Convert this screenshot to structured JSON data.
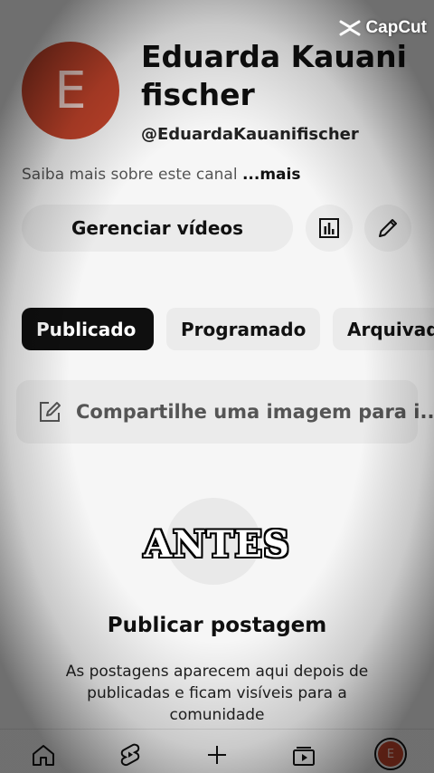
{
  "watermark": {
    "label": "CapCut",
    "icon": "capcut-logo-icon"
  },
  "channel": {
    "avatar_letter": "E",
    "avatar_color": "#c4442b",
    "name": "Eduarda Kauani fischer",
    "handle": "@EduardaKauanifischer",
    "about_text": "Saiba mais sobre este canal ",
    "about_more": "...mais"
  },
  "actions": {
    "manage_videos": "Gerenciar vídeos",
    "analytics_icon": "analytics-icon",
    "edit_icon": "pencil-icon"
  },
  "tabs": [
    {
      "label": "Publicado",
      "active": true
    },
    {
      "label": "Programado",
      "active": false
    },
    {
      "label": "Arquivad",
      "active": false
    }
  ],
  "compose": {
    "placeholder": "Compartilhe uma imagem para i..."
  },
  "overlay_text": "ANTES",
  "empty_state": {
    "title": "Publicar postagem",
    "description": "As postagens aparecem aqui depois de publicadas e ficam visíveis para a comunidade"
  },
  "bottom_nav": {
    "items": [
      "home-icon",
      "shorts-icon",
      "create-icon",
      "subscriptions-icon",
      "profile-avatar"
    ],
    "avatar_letter": "E"
  }
}
